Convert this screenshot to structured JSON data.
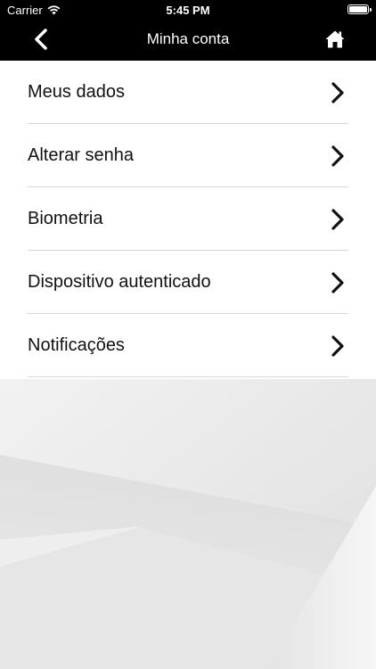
{
  "status_bar": {
    "carrier": "Carrier",
    "wifi_icon": "wifi-icon",
    "time": "5:45 PM",
    "battery_icon": "battery-icon"
  },
  "nav_bar": {
    "title": "Minha conta",
    "back_icon": "chevron-left-icon",
    "home_icon": "home-icon"
  },
  "menu": {
    "items": [
      {
        "label": "Meus dados",
        "icon": "chevron-right-icon"
      },
      {
        "label": "Alterar senha",
        "icon": "chevron-right-icon"
      },
      {
        "label": "Biometria",
        "icon": "chevron-right-icon"
      },
      {
        "label": "Dispositivo autenticado",
        "icon": "chevron-right-icon"
      },
      {
        "label": "Notificações",
        "icon": "chevron-right-icon"
      }
    ]
  },
  "colors": {
    "header_bg": "#000000",
    "header_text": "#ffffff",
    "menu_bg": "#ffffff",
    "divider": "#d4d4d4",
    "background": "#ededed"
  }
}
